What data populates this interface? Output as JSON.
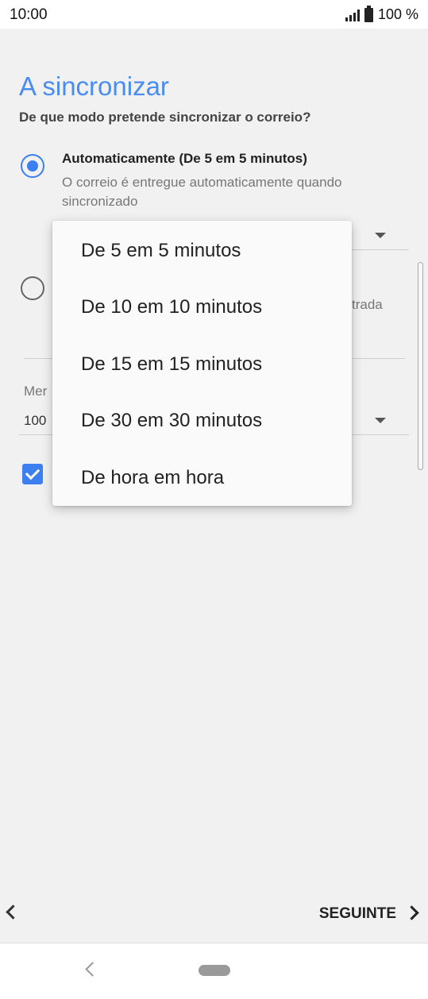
{
  "status_bar": {
    "time": "10:00",
    "battery": "100 %"
  },
  "screen": {
    "title": "A sincronizar",
    "subtitle": "De que modo pretende sincronizar o correio?"
  },
  "options": {
    "auto_label": "Automaticamente (De 5 em 5 minutos)",
    "auto_desc": "O correio é entregue automaticamente quando sincronizado",
    "second_fragment": "trada",
    "field_label_fragment": "Mer",
    "field_value_fragment": "100"
  },
  "dropdown": {
    "items": [
      "De 5 em 5 minutos",
      "De 10 em 10 minutos",
      "De 15 em 15 minutos",
      "De 30 em 30 minutos",
      "De hora em hora"
    ]
  },
  "nav": {
    "next_label": "SEGUINTE"
  },
  "colors": {
    "accent": "#3b7ff0",
    "title": "#4a8df0",
    "background": "#f1f1f1"
  },
  "icons": [
    "signal-icon",
    "battery-icon",
    "radio-checked-icon",
    "radio-unchecked-icon",
    "checkbox-checked-icon",
    "chevron-left-icon",
    "chevron-right-icon",
    "dropdown-caret-icon"
  ]
}
